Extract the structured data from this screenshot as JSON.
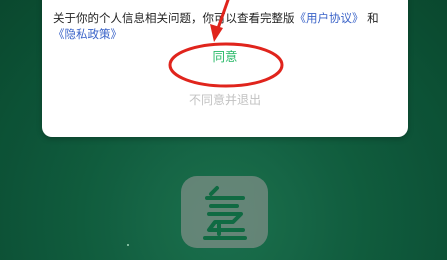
{
  "dialog": {
    "text_prefix": "关于你的个人信息相关问题，你可以查看完整版",
    "user_agreement_link": "《用户协议》",
    "conjunction": " 和",
    "privacy_policy_link": "《隐私政策》",
    "agree_label": "同意",
    "disagree_label": "不同意并退出"
  },
  "colors": {
    "agree_green": "#25b866",
    "link_blue": "#3a63c8",
    "annotation_red": "#e0241c",
    "background_green": "#126443"
  },
  "icons": {
    "app": "app-logo-icon",
    "annotation_arrow": "red-arrow-annotation",
    "annotation_circle": "red-circle-annotation"
  }
}
